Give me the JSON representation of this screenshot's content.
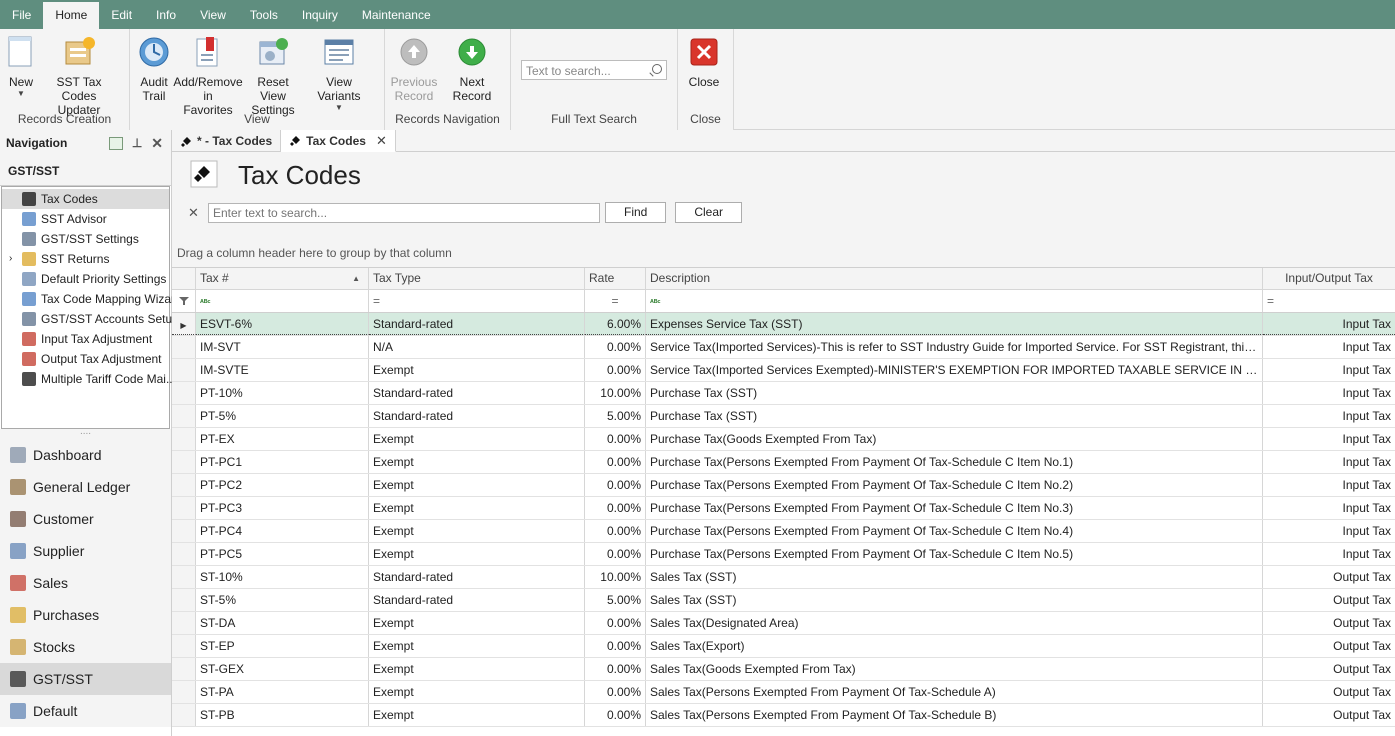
{
  "menubar": {
    "tabs": [
      "File",
      "Home",
      "Edit",
      "Info",
      "View",
      "Tools",
      "Inquiry",
      "Maintenance"
    ],
    "active": "Home"
  },
  "ribbon": {
    "groups": {
      "records_creation": "Records Creation",
      "view": "View",
      "records_navigation": "Records Navigation",
      "full_text_search": "Full Text Search",
      "close": "Close"
    },
    "buttons": {
      "new": "New",
      "sst_updater_1": "SST Tax Codes",
      "sst_updater_2": "Updater",
      "audit_1": "Audit",
      "audit_2": "Trail",
      "fav_1": "Add/Remove",
      "fav_2": "in Favorites",
      "reset_1": "Reset View",
      "reset_2": "Settings",
      "variants": "View Variants",
      "prev_1": "Previous",
      "prev_2": "Record",
      "next": "Next Record",
      "close": "Close"
    },
    "search_placeholder": "Text to search..."
  },
  "nav": {
    "header": "Navigation",
    "section": "GST/SST",
    "tree": [
      {
        "label": "Tax Codes",
        "icon": "tax-code-icon",
        "selected": true
      },
      {
        "label": "SST Advisor",
        "icon": "advisor-icon"
      },
      {
        "label": "GST/SST Settings",
        "icon": "settings-gear-icon"
      },
      {
        "label": "SST Returns",
        "icon": "returns-icon",
        "expandable": true
      },
      {
        "label": "Default Priority Settings",
        "icon": "priority-icon"
      },
      {
        "label": "Tax Code Mapping Wizard",
        "icon": "wizard-icon"
      },
      {
        "label": "GST/SST Accounts Setup",
        "icon": "accounts-icon"
      },
      {
        "label": "Input Tax Adjustment",
        "icon": "adjustment-icon"
      },
      {
        "label": "Output Tax Adjustment",
        "icon": "adjustment-icon"
      },
      {
        "label": "Multiple Tariff Code Mai...",
        "icon": "tariff-icon"
      }
    ],
    "modules": [
      {
        "label": "Dashboard",
        "icon": "dashboard-icon"
      },
      {
        "label": "General Ledger",
        "icon": "ledger-icon"
      },
      {
        "label": "Customer",
        "icon": "customer-icon"
      },
      {
        "label": "Supplier",
        "icon": "supplier-icon"
      },
      {
        "label": "Sales",
        "icon": "sales-icon"
      },
      {
        "label": "Purchases",
        "icon": "purchases-icon"
      },
      {
        "label": "Stocks",
        "icon": "stocks-icon"
      },
      {
        "label": "GST/SST",
        "icon": "gst-icon",
        "active": true
      },
      {
        "label": "Default",
        "icon": "default-icon"
      }
    ]
  },
  "doctabs": [
    {
      "label": "* - Tax Codes",
      "active": false
    },
    {
      "label": "Tax Codes",
      "active": true
    }
  ],
  "page": {
    "title": "Tax Codes",
    "search_placeholder": "Enter text to search...",
    "find": "Find",
    "clear": "Clear",
    "groupby_hint": "Drag a column header here to group by that column"
  },
  "grid": {
    "columns": [
      "Tax #",
      "Tax Type",
      "Rate",
      "Description",
      "Input/Output Tax"
    ],
    "rows": [
      [
        "ESVT-6%",
        "Standard-rated",
        "6.00%",
        "Expenses Service Tax (SST)",
        "Input Tax"
      ],
      [
        "IM-SVT",
        "N/A",
        "0.00%",
        "Service Tax(Imported Services)-This is refer to SST Industry Guide for Imported Service. For SST Registrant, this tax code wi...",
        "Input Tax"
      ],
      [
        "IM-SVTE",
        "Exempt",
        "0.00%",
        "Service Tax(Imported Services Exempted)-MINISTER'S EXEMPTION FOR IMPORTED TAXABLE SERVICE IN GROUP G (PROFES...",
        "Input Tax"
      ],
      [
        "PT-10%",
        "Standard-rated",
        "10.00%",
        "Purchase Tax (SST)",
        "Input Tax"
      ],
      [
        "PT-5%",
        "Standard-rated",
        "5.00%",
        "Purchase Tax (SST)",
        "Input Tax"
      ],
      [
        "PT-EX",
        "Exempt",
        "0.00%",
        "Purchase Tax(Goods Exempted From Tax)",
        "Input Tax"
      ],
      [
        "PT-PC1",
        "Exempt",
        "0.00%",
        "Purchase Tax(Persons Exempted From Payment Of Tax-Schedule C Item No.1)",
        "Input Tax"
      ],
      [
        "PT-PC2",
        "Exempt",
        "0.00%",
        "Purchase Tax(Persons Exempted From Payment Of Tax-Schedule C Item No.2)",
        "Input Tax"
      ],
      [
        "PT-PC3",
        "Exempt",
        "0.00%",
        "Purchase Tax(Persons Exempted From Payment Of Tax-Schedule C Item No.3)",
        "Input Tax"
      ],
      [
        "PT-PC4",
        "Exempt",
        "0.00%",
        "Purchase Tax(Persons Exempted From Payment Of Tax-Schedule C Item No.4)",
        "Input Tax"
      ],
      [
        "PT-PC5",
        "Exempt",
        "0.00%",
        "Purchase Tax(Persons Exempted From Payment Of Tax-Schedule C Item No.5)",
        "Input Tax"
      ],
      [
        "ST-10%",
        "Standard-rated",
        "10.00%",
        "Sales Tax (SST)",
        "Output Tax"
      ],
      [
        "ST-5%",
        "Standard-rated",
        "5.00%",
        "Sales Tax (SST)",
        "Output Tax"
      ],
      [
        "ST-DA",
        "Exempt",
        "0.00%",
        "Sales Tax(Designated Area)",
        "Output Tax"
      ],
      [
        "ST-EP",
        "Exempt",
        "0.00%",
        "Sales Tax(Export)",
        "Output Tax"
      ],
      [
        "ST-GEX",
        "Exempt",
        "0.00%",
        "Sales Tax(Goods Exempted From Tax)",
        "Output Tax"
      ],
      [
        "ST-PA",
        "Exempt",
        "0.00%",
        "Sales Tax(Persons Exempted From Payment Of Tax-Schedule A)",
        "Output Tax"
      ],
      [
        "ST-PB",
        "Exempt",
        "0.00%",
        "Sales Tax(Persons Exempted From Payment Of Tax-Schedule B)",
        "Output Tax"
      ]
    ]
  }
}
